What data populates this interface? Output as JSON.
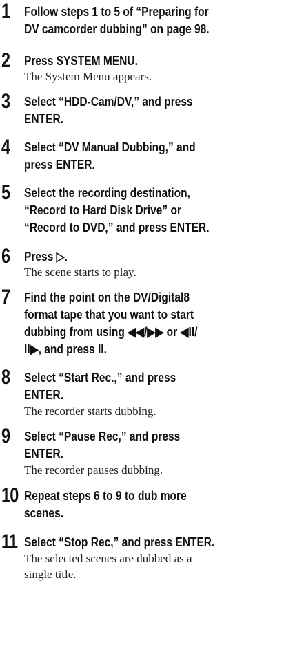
{
  "steps": [
    {
      "number": "1",
      "lines": [
        "Follow steps 1 to 5 of “Preparing for",
        "DV camcorder dubbing” on page 98."
      ],
      "desc": []
    },
    {
      "number": "2",
      "lines": [
        "Press SYSTEM MENU."
      ],
      "desc": [
        "The System Menu appears."
      ]
    },
    {
      "number": "3",
      "lines": [
        "Select “HDD-Cam/DV,” and press",
        "ENTER."
      ],
      "desc": []
    },
    {
      "number": "4",
      "lines": [
        "Select “DV Manual Dubbing,” and",
        "press ENTER."
      ],
      "desc": []
    },
    {
      "number": "5",
      "lines": [
        "Select the recording destination,",
        "“Record to Hard Disk Drive” or",
        "“Record to DVD,” and press ENTER."
      ],
      "desc": []
    },
    {
      "number": "6",
      "lines": [
        "Press ▷."
      ],
      "desc": [
        "The scene starts to play."
      ]
    },
    {
      "number": "7",
      "lines": [
        "Find the point on the DV/Digital8",
        "format tape that you want to start",
        "dubbing from using ◀◀/▶▶ or ◀II/",
        "II▶, and press II."
      ],
      "desc": []
    },
    {
      "number": "8",
      "lines": [
        "Select “Start Rec.,” and press",
        "ENTER."
      ],
      "desc": [
        "The recorder starts dubbing."
      ]
    },
    {
      "number": "9",
      "lines": [
        "Select “Pause Rec,” and press",
        "ENTER."
      ],
      "desc": [
        "The recorder pauses dubbing."
      ]
    },
    {
      "number": "10",
      "lines": [
        "Repeat steps 6 to 9 to dub more",
        "scenes."
      ],
      "desc": []
    },
    {
      "number": "11",
      "lines": [
        "Select “Stop Rec,” and press ENTER."
      ],
      "desc": [
        "The selected scenes are dubbed as a",
        "single title."
      ]
    }
  ]
}
